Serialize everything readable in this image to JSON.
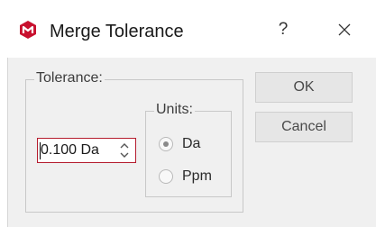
{
  "window": {
    "title": "Merge Tolerance",
    "help_label": "?",
    "close_label": "×",
    "icon": "app-logo-icon",
    "accent_color": "#c8102e"
  },
  "tolerance_group": {
    "legend": "Tolerance:",
    "value": "0.100 Da"
  },
  "units_group": {
    "legend": "Units:",
    "options": [
      {
        "label": "Da",
        "selected": true
      },
      {
        "label": "Ppm",
        "selected": false
      }
    ]
  },
  "buttons": {
    "ok_label": "OK",
    "cancel_label": "Cancel"
  }
}
